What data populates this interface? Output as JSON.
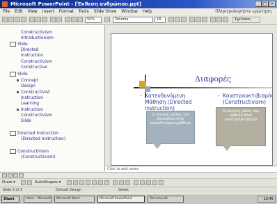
{
  "window": {
    "title": "Microsoft PowerPoint - [Έκθεση ανθρώπου.ppt]",
    "minimize": "_",
    "maximize": "□",
    "close": "×"
  },
  "menu": {
    "items": [
      "File",
      "Edit",
      "View",
      "Insert",
      "Format",
      "Tools",
      "Slide Show",
      "Window",
      "Help"
    ],
    "help_hint": "Πληκτρολογήστε ερώτηση"
  },
  "toolbar": {
    "zoom": "50%",
    "font": "Tahoma",
    "size": "18",
    "design": "Σχεδίαση"
  },
  "outline": {
    "items": [
      {
        "kind": "text",
        "text": "Constructivism"
      },
      {
        "kind": "text",
        "text": "Introductionism"
      },
      {
        "kind": "slide",
        "text": "Slide"
      },
      {
        "kind": "text",
        "text": "Directed"
      },
      {
        "kind": "text",
        "text": "Instruction"
      },
      {
        "kind": "text",
        "text": "Constructivism"
      },
      {
        "kind": "text",
        "text": "Constructive"
      },
      {
        "kind": "slide",
        "text": "Slide"
      },
      {
        "kind": "bullet",
        "text": "Concept"
      },
      {
        "kind": "text",
        "text": "Design"
      },
      {
        "kind": "bullet",
        "text": "Constructivist"
      },
      {
        "kind": "text",
        "text": "Instruction"
      },
      {
        "kind": "text",
        "text": "Learning"
      },
      {
        "kind": "bullet",
        "text": "Instruction"
      },
      {
        "kind": "text",
        "text": "Constructivism"
      },
      {
        "kind": "text",
        "text": "Slide"
      },
      {
        "kind": "slide",
        "text": "Directed Instruction"
      },
      {
        "kind": "text",
        "text": "(Directed Instruction)"
      },
      {
        "kind": "slide",
        "text": "Constructivism"
      },
      {
        "kind": "text",
        "text": "(Constructivism)"
      }
    ]
  },
  "slide": {
    "title": "Διαφορές",
    "left_col": [
      "Κατευθυνόμενη",
      "Μάθηση (Directed",
      "Instruction)"
    ],
    "right_col": [
      "Κονστρουκτιβισμός",
      "(Constructivism)"
    ],
    "callout_left": "Ο ενεργός ρόλος του δασκάλου στην κατευθυνόμενη μάθηση",
    "callout_right": "Ο ενεργός ρόλος του μαθητή στον κονστρουκτιβισμό"
  },
  "notes": {
    "placeholder": "Click to add notes"
  },
  "drawbar": {
    "draw": "Draw ▾",
    "autoshapes": "AutoShapes ▾"
  },
  "status": {
    "slide_info": "Slide 3 of 3",
    "design": "Default Design",
    "lang": "Greek"
  },
  "taskbar": {
    "start": "Start",
    "tasks": [
      "Inbox - Microsoft Outlook",
      "Microsoft Word",
      "Microsoft PowerPoint",
      "Document1"
    ],
    "clock": "10:45"
  },
  "colors": {
    "title_blue": "#2a3f9c",
    "accent_gold": "#d9a623",
    "callout_blue_grey": "#a5b1bc",
    "callout_taupe": "#b3b0a1"
  }
}
